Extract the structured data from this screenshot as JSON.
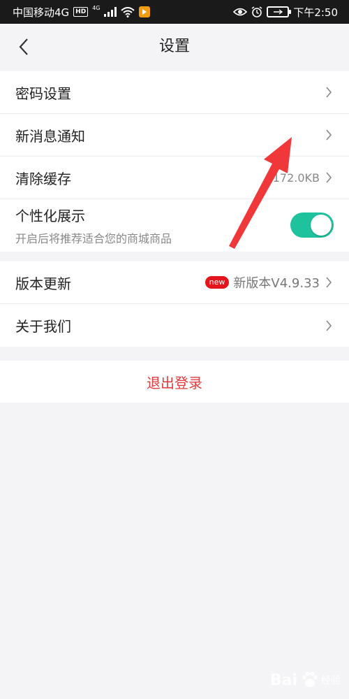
{
  "status_bar": {
    "carrier": "中国移动4G",
    "hd": "HD",
    "net_small": "4G",
    "time": "下午2:50"
  },
  "header": {
    "title": "设置"
  },
  "group1": {
    "password": {
      "label": "密码设置"
    },
    "notifications": {
      "label": "新消息通知"
    },
    "cache": {
      "label": "清除缓存",
      "value": "172.0KB"
    },
    "personalized": {
      "label": "个性化展示",
      "subtext": "开启后将推荐适合您的商城商品",
      "enabled": true
    }
  },
  "group2": {
    "update": {
      "label": "版本更新",
      "badge": "new",
      "value": "新版本V4.9.33"
    },
    "about": {
      "label": "关于我们"
    }
  },
  "logout": {
    "label": "退出登录"
  },
  "watermark": {
    "text": "Bai",
    "sub": "经验"
  },
  "colors": {
    "accent_toggle": "#1ec29c",
    "logout_red": "#e33b3b",
    "badge_red": "#e3141b",
    "annotation_arrow": "#f0383b"
  }
}
